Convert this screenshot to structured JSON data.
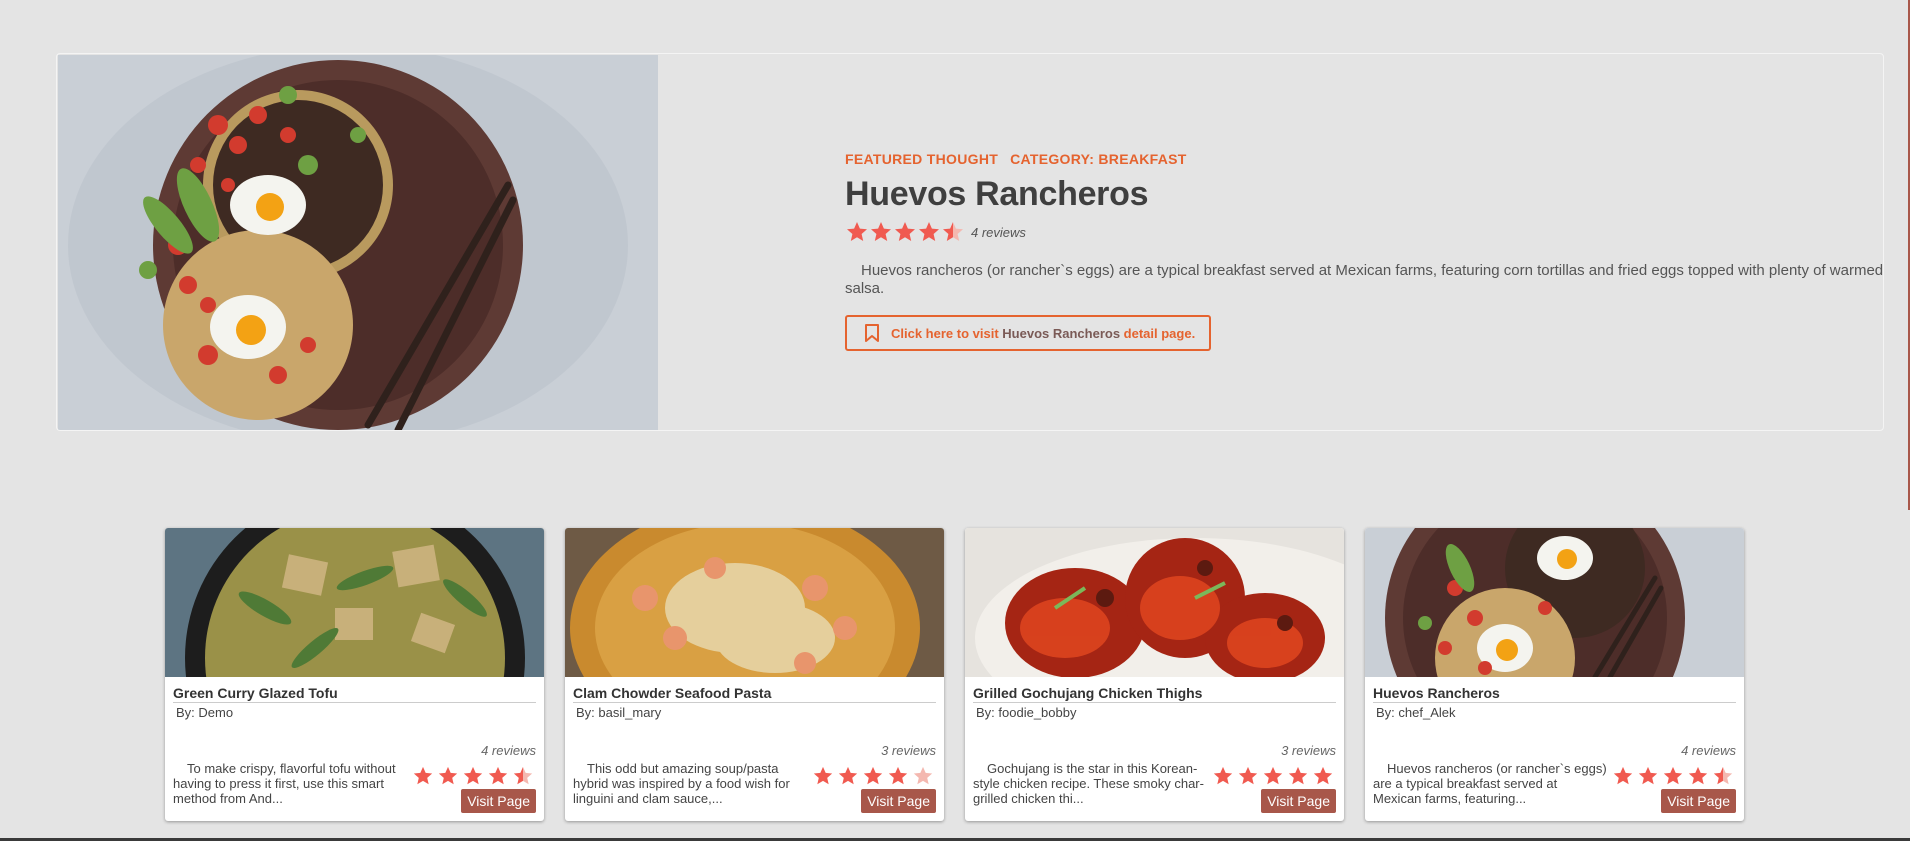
{
  "hero": {
    "tag_featured": "FEATURED THOUGHT",
    "tag_category": "CATEGORY: BREAKFAST",
    "title": "Huevos Rancheros",
    "rating": 4.5,
    "reviews": "4 reviews",
    "description": "Huevos rancheros (or rancher`s eggs) are a typical breakfast served at Mexican farms, featuring corn tortillas and fried eggs topped with plenty of warmed salsa.",
    "button_prefix": "Click here to visit",
    "button_name": "Huevos Rancheros",
    "button_suffix": "detail page.",
    "bookmark_icon": "bookmark-icon"
  },
  "cards": [
    {
      "title": "Green Curry Glazed Tofu",
      "author": "By: Demo",
      "reviews": "4 reviews",
      "rating": 4.5,
      "description": "To make crispy, flavorful tofu without having to press it first, use this smart method from And...",
      "button": "Visit Page"
    },
    {
      "title": "Clam Chowder Seafood Pasta",
      "author": "By: basil_mary",
      "reviews": "3 reviews",
      "rating": 4,
      "description": "This odd but amazing soup/pasta hybrid was inspired by a food wish for linguini and clam sauce,...",
      "button": "Visit Page"
    },
    {
      "title": "Grilled Gochujang Chicken Thighs",
      "author": "By: foodie_bobby",
      "reviews": "3 reviews",
      "rating": 5,
      "description": "Gochujang is the star in this Korean-style chicken recipe. These smoky char-grilled chicken thi...",
      "button": "Visit Page"
    },
    {
      "title": "Huevos Rancheros",
      "author": "By: chef_Alek",
      "reviews": "4 reviews",
      "rating": 4.5,
      "description": "Huevos rancheros (or rancher`s eggs) are a typical breakfast served at Mexican farms, featuring...",
      "button": "Visit Page"
    }
  ],
  "colors": {
    "accent": "#e5632f",
    "star": "#f05a50",
    "star_empty": "#f4b8b0",
    "button": "#a8574a",
    "background": "#e4e4e4"
  }
}
